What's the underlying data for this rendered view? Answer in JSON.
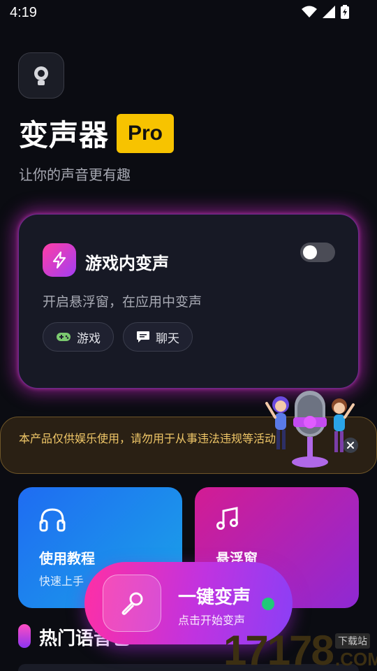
{
  "status_bar": {
    "time": "4:19"
  },
  "header": {
    "app_name": "变声器",
    "badge": "Pro",
    "subtitle": "让你的声音更有趣"
  },
  "ingame_card": {
    "title": "游戏内变声",
    "description": "开启悬浮窗，在应用中变声",
    "toggle_on": false,
    "chips": [
      "游戏",
      "聊天"
    ]
  },
  "notice": {
    "text": "本产品仅供娱乐使用，请勿用于从事违法违规等活动"
  },
  "tiles": [
    {
      "title": "使用教程",
      "subtitle": "快速上手"
    },
    {
      "title": "悬浮窗",
      "subtitle": ""
    }
  ],
  "section": {
    "title": "热门语音包"
  },
  "fab": {
    "title": "一键变声",
    "subtitle": "点击开始变声"
  },
  "watermark": {
    "number": "17178",
    "tag": "下载站",
    "domain": ".COM"
  },
  "colors": {
    "background": "#0b0c12",
    "pro_badge": "#f7c300",
    "card_glow": "#c828c8",
    "notice_text": "#f0c768",
    "tutorial_tile": "#1f6cf2",
    "float_tile": "#d31c93",
    "fab_start": "#ff2fa4",
    "fab_end": "#8a3ff6",
    "status_dot": "#20c978"
  },
  "icons": {
    "logo": "mic-icon",
    "card": "lightning-icon",
    "chip_game": "gamepad-icon",
    "chip_chat": "chat-icon",
    "tutorial": "headphones-icon",
    "float": "music-note-icon",
    "fab": "microphone-icon"
  }
}
